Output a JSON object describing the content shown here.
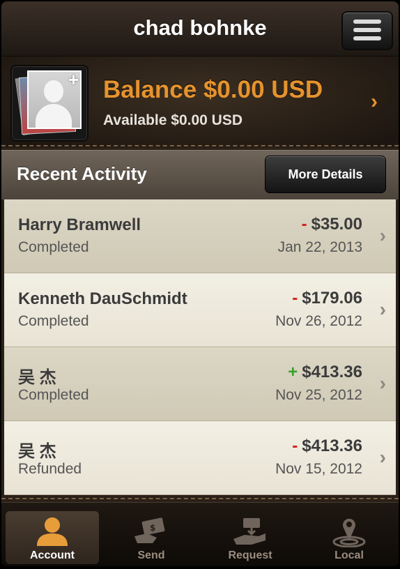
{
  "header": {
    "title": "chad bohnke"
  },
  "balance": {
    "amount_text": "Balance $0.00 USD",
    "available_text": "Available $0.00 USD"
  },
  "recent": {
    "label": "Recent Activity",
    "more_details": "More Details"
  },
  "transactions": [
    {
      "name": "Harry Bramwell",
      "status": "Completed",
      "sign": "-",
      "amount": "$35.00",
      "date": "Jan 22, 2013"
    },
    {
      "name": "Kenneth DauSchmidt",
      "status": "Completed",
      "sign": "-",
      "amount": "$179.06",
      "date": "Nov 26, 2012"
    },
    {
      "name": "吴 杰",
      "status": "Completed",
      "sign": "+",
      "amount": "$413.36",
      "date": "Nov 25, 2012"
    },
    {
      "name": "吴 杰",
      "status": "Refunded",
      "sign": "-",
      "amount": "$413.36",
      "date": "Nov 15, 2012"
    }
  ],
  "tabs": [
    {
      "label": "Account",
      "icon": "account-icon",
      "active": true
    },
    {
      "label": "Send",
      "icon": "send-money-icon",
      "active": false
    },
    {
      "label": "Request",
      "icon": "request-money-icon",
      "active": false
    },
    {
      "label": "Local",
      "icon": "local-pin-icon",
      "active": false
    }
  ],
  "colors": {
    "balance_accent": "#e6932e",
    "negative": "#d21b1b",
    "positive": "#3aa12a"
  }
}
